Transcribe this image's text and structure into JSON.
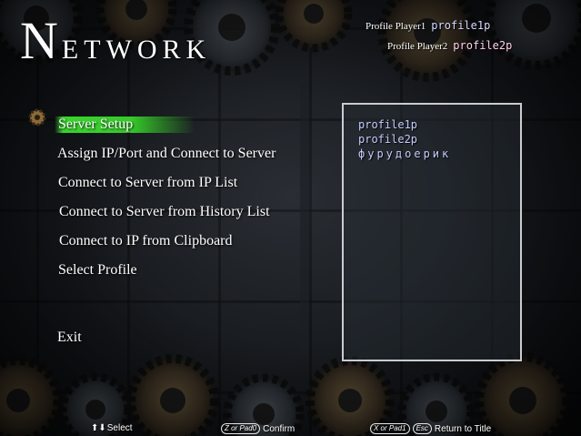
{
  "title": {
    "first": "N",
    "rest": "ETWORK"
  },
  "profiles": {
    "p1_label": "Profile Player1",
    "p1_value": "profile1p",
    "p2_label": "Profile Player2",
    "p2_value": "profile2p"
  },
  "menu": {
    "items": [
      "Server Setup",
      "Assign IP/Port and Connect to Server",
      "Connect to Server from IP List",
      "Connect to Server from History List",
      "Connect to IP from Clipboard",
      "Select Profile",
      "Exit"
    ],
    "selected_index": 0
  },
  "profile_list": [
    "profile1p",
    "profile2p",
    "фурудоерик"
  ],
  "hints": {
    "select_icon": "up-down-arrow-icon",
    "select_label": "Select",
    "confirm_key": "Z or Pad0",
    "confirm_label": "Confirm",
    "back_key1": "X or Pad1",
    "back_key2": "Esc",
    "back_label": "Return to Title"
  },
  "colors": {
    "highlight": "#38d52c",
    "list_text": "#c5cbff",
    "panel_border": "#c9ccd1"
  }
}
